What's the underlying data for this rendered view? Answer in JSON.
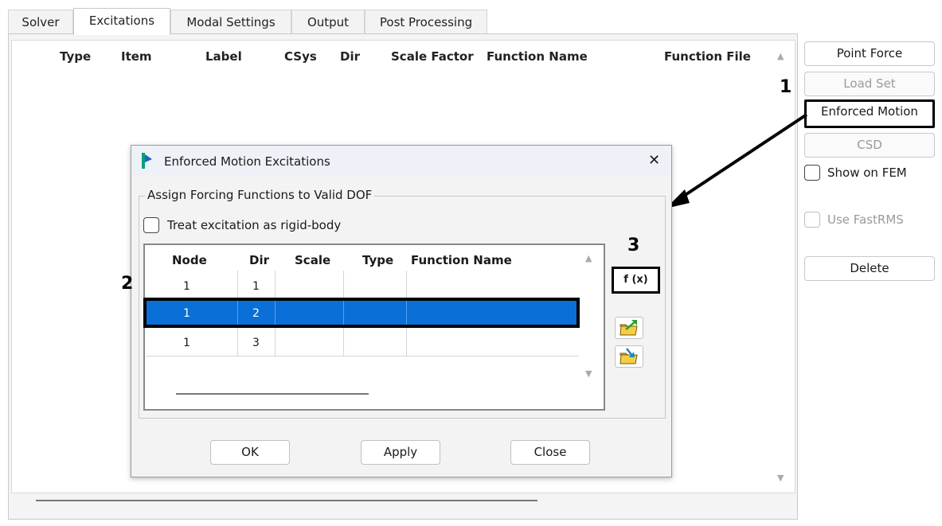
{
  "tabs": [
    "Solver",
    "Excitations",
    "Modal Settings",
    "Output",
    "Post Processing"
  ],
  "main_columns": [
    "Type",
    "Item",
    "Label",
    "CSys",
    "Dir",
    "Scale Factor",
    "Function Name",
    "Function File"
  ],
  "right_buttons": {
    "point_force": "Point Force",
    "load_set": "Load Set",
    "enforced_motion": "Enforced Motion",
    "csd": "CSD",
    "delete": "Delete"
  },
  "checkboxes": {
    "show_on_fem": "Show on FEM",
    "use_fastrms": "Use FastRMS"
  },
  "callouts": {
    "one": "1",
    "two": "2",
    "three": "3"
  },
  "dialog": {
    "title": "Enforced Motion Excitations",
    "close_glyph": "✕",
    "group_label": "Assign Forcing Functions to Valid DOF",
    "rigid_body_label": "Treat excitation as rigid-body",
    "columns": [
      "Node",
      "Dir",
      "Scale",
      "Type",
      "Function Name"
    ],
    "rows": [
      {
        "node": "1",
        "dir": "1"
      },
      {
        "node": "1",
        "dir": "2"
      },
      {
        "node": "1",
        "dir": "3"
      }
    ],
    "fx_label": "f (x)",
    "ok": "OK",
    "apply": "Apply",
    "close": "Close"
  },
  "colors": {
    "selection": "#0a6fd6",
    "highlight": "#000000"
  }
}
